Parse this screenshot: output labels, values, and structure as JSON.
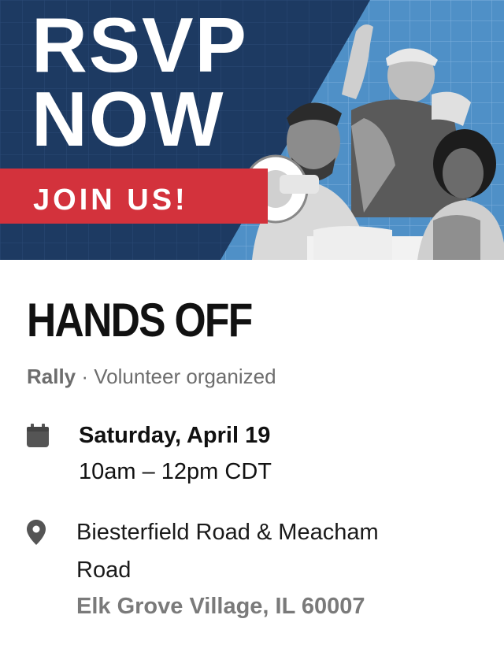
{
  "banner": {
    "headline_line1": "RSVP",
    "headline_line2": "NOW",
    "join_label": "JOIN US!",
    "colors": {
      "navy": "#1d3a62",
      "red": "#d3323c",
      "light_blue": "#4f90c7"
    }
  },
  "event": {
    "title": "HANDS OFF",
    "kind": "Rally",
    "separator": " · ",
    "organizer": "Volunteer organized",
    "date": "Saturday, April 19",
    "time": "10am – 12pm CDT",
    "address": "Biesterfield Road & Meacham Road",
    "city": "Elk Grove Village, IL 60007"
  },
  "icons": {
    "date": "calendar-icon",
    "location": "location-pin-icon"
  }
}
